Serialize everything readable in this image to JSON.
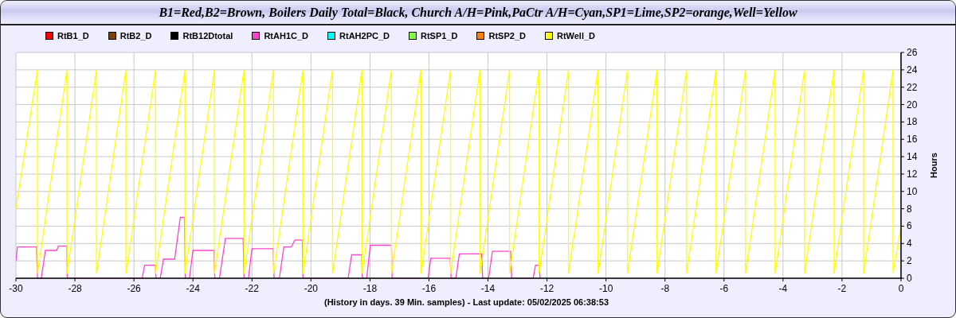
{
  "window": {
    "title": "B1=Red,B2=Brown, Boilers Daily Total=Black, Church A/H=Pink,PaCtr A/H=Cyan,SP1=Lime,SP2=orange,Well=Yellow"
  },
  "chart": {
    "chart_data": {
      "type": "line",
      "grid": true,
      "xlabel": "(History in days. 39 Min. samples) - Last update: 05/02/2025 06:38:53",
      "ylabel": "Hours",
      "xlim": [
        -30,
        0
      ],
      "ylim": [
        0,
        26
      ],
      "xticks": [
        -30,
        -28,
        -26,
        -24,
        -22,
        -20,
        -18,
        -16,
        -14,
        -12,
        -10,
        -8,
        -6,
        -4,
        -2,
        0
      ],
      "yticks": [
        0,
        2,
        4,
        6,
        8,
        10,
        12,
        14,
        16,
        18,
        20,
        22,
        24,
        26
      ],
      "series": [
        {
          "name": "RtB1_D",
          "color": "#ff0000"
        },
        {
          "name": "RtB2_D",
          "color": "#804000"
        },
        {
          "name": "RtB12Dtotal",
          "color": "#000000"
        },
        {
          "name": "RtAH1C_D",
          "color": "#ff44cc",
          "x": [
            -30,
            -29.95,
            -29.3,
            -29.27,
            -29.14,
            -29.0,
            -28.62,
            -28.56,
            -28.28,
            -28.26,
            -25.72,
            -25.64,
            -25.28,
            -25.25,
            -25.11,
            -25.0,
            -24.62,
            -24.43,
            -24.29,
            -24.26,
            -24.12,
            -24.0,
            -23.29,
            -23.26,
            -23.1,
            -22.9,
            -22.3,
            -22.27,
            -22.12,
            -22.0,
            -21.28,
            -21.25,
            -21.07,
            -20.92,
            -20.67,
            -20.54,
            -20.29,
            -20.27,
            -18.74,
            -18.62,
            -18.28,
            -18.26,
            -18.11,
            -17.99,
            -17.27,
            -17.25,
            -16.03,
            -15.94,
            -15.28,
            -15.25,
            -15.09,
            -14.97,
            -14.22,
            -14.18,
            -13.98,
            -13.85,
            -13.23,
            -13.2,
            -12.47,
            -12.39,
            -12.27,
            -12.23
          ],
          "values": [
            2.0,
            3.6,
            3.6,
            0,
            0,
            3.2,
            3.2,
            3.7,
            3.7,
            0,
            0,
            1.5,
            1.5,
            0,
            0,
            2.2,
            2.2,
            7.0,
            7.0,
            0,
            0,
            3.2,
            3.2,
            0,
            0,
            4.6,
            4.6,
            0,
            0,
            3.4,
            3.4,
            0,
            0,
            3.6,
            3.6,
            4.4,
            4.4,
            0,
            0,
            2.7,
            2.7,
            0,
            0,
            3.8,
            3.8,
            0,
            0,
            2.3,
            2.3,
            0,
            0,
            2.8,
            2.8,
            0,
            0,
            3.1,
            3.1,
            0,
            0,
            1.5,
            1.5,
            0
          ]
        },
        {
          "name": "RtAH2PC_D",
          "color": "#00ffff"
        },
        {
          "name": "RtSP1_D",
          "color": "#80ff40"
        },
        {
          "name": "RtSP2_D",
          "color": "#ff8000"
        },
        {
          "name": "RtWell_D",
          "color": "#ffff00",
          "x": [
            -30,
            -29.27,
            -29.27,
            -28.27,
            -28.27,
            -27.27,
            -27.27,
            -26.27,
            -26.27,
            -25.27,
            -25.27,
            -24.27,
            -24.27,
            -23.27,
            -23.27,
            -22.27,
            -22.27,
            -21.27,
            -21.27,
            -20.27,
            -20.27,
            -19.27,
            -19.27,
            -18.27,
            -18.27,
            -17.27,
            -17.27,
            -16.27,
            -16.27,
            -15.27,
            -15.27,
            -14.27,
            -14.27,
            -13.27,
            -13.27,
            -12.27,
            -12.27,
            -11.27,
            -11.27,
            -10.27,
            -10.27,
            -9.27,
            -9.27,
            -8.27,
            -8.27,
            -7.27,
            -7.27,
            -6.27,
            -6.27,
            -5.27,
            -5.27,
            -4.27,
            -4.27,
            -3.27,
            -3.27,
            -2.27,
            -2.27,
            -1.27,
            -1.27,
            -0.27,
            -0.27,
            0
          ],
          "values": [
            8,
            24,
            0.5,
            24,
            0.5,
            24,
            0.5,
            24,
            0.5,
            24,
            0.5,
            24,
            0.5,
            24,
            0.5,
            24,
            0.5,
            24,
            0.5,
            24,
            0.5,
            24,
            0.5,
            24,
            0.5,
            24,
            0.5,
            24,
            0.5,
            24,
            0.5,
            24,
            0.5,
            24,
            0.5,
            24,
            0.5,
            24,
            0.5,
            24,
            0.5,
            24,
            0.5,
            24,
            0.5,
            24,
            0.5,
            24,
            0.5,
            24,
            0.5,
            24,
            0.5,
            24,
            0.5,
            24,
            0.5,
            24,
            0.5,
            24,
            0.6,
            6
          ]
        }
      ]
    }
  }
}
